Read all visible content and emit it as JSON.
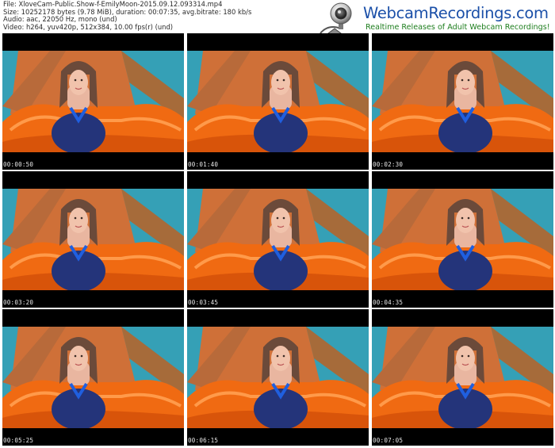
{
  "file_info": {
    "file": "File: XloveCam-Public.Show-f-EmilyMoon-2015.09.12.093314.mp4",
    "size": "Size: 10252178 bytes (9.78 MiB), duration: 00:07:35, avg.bitrate: 180 kb/s",
    "audio": "Audio: aac, 22050 Hz, mono (und)",
    "video": "Video: h264, yuv420p, 512x384, 10.00 fps(r) (und)"
  },
  "logo": {
    "title": "WebcamRecordings.com",
    "subtitle": "Realtime Releases of Adult Webcam Recordings!",
    "icon": "webcam-icon",
    "title_color": "#1a4fa8",
    "subtitle_color": "#1e7e1e"
  },
  "thumbnails": [
    {
      "timestamp": "00:00:50"
    },
    {
      "timestamp": "00:01:40"
    },
    {
      "timestamp": "00:02:30"
    },
    {
      "timestamp": "00:03:20"
    },
    {
      "timestamp": "00:03:45"
    },
    {
      "timestamp": "00:04:35"
    },
    {
      "timestamp": "00:05:25"
    },
    {
      "timestamp": "00:06:15"
    },
    {
      "timestamp": "00:07:05"
    }
  ]
}
